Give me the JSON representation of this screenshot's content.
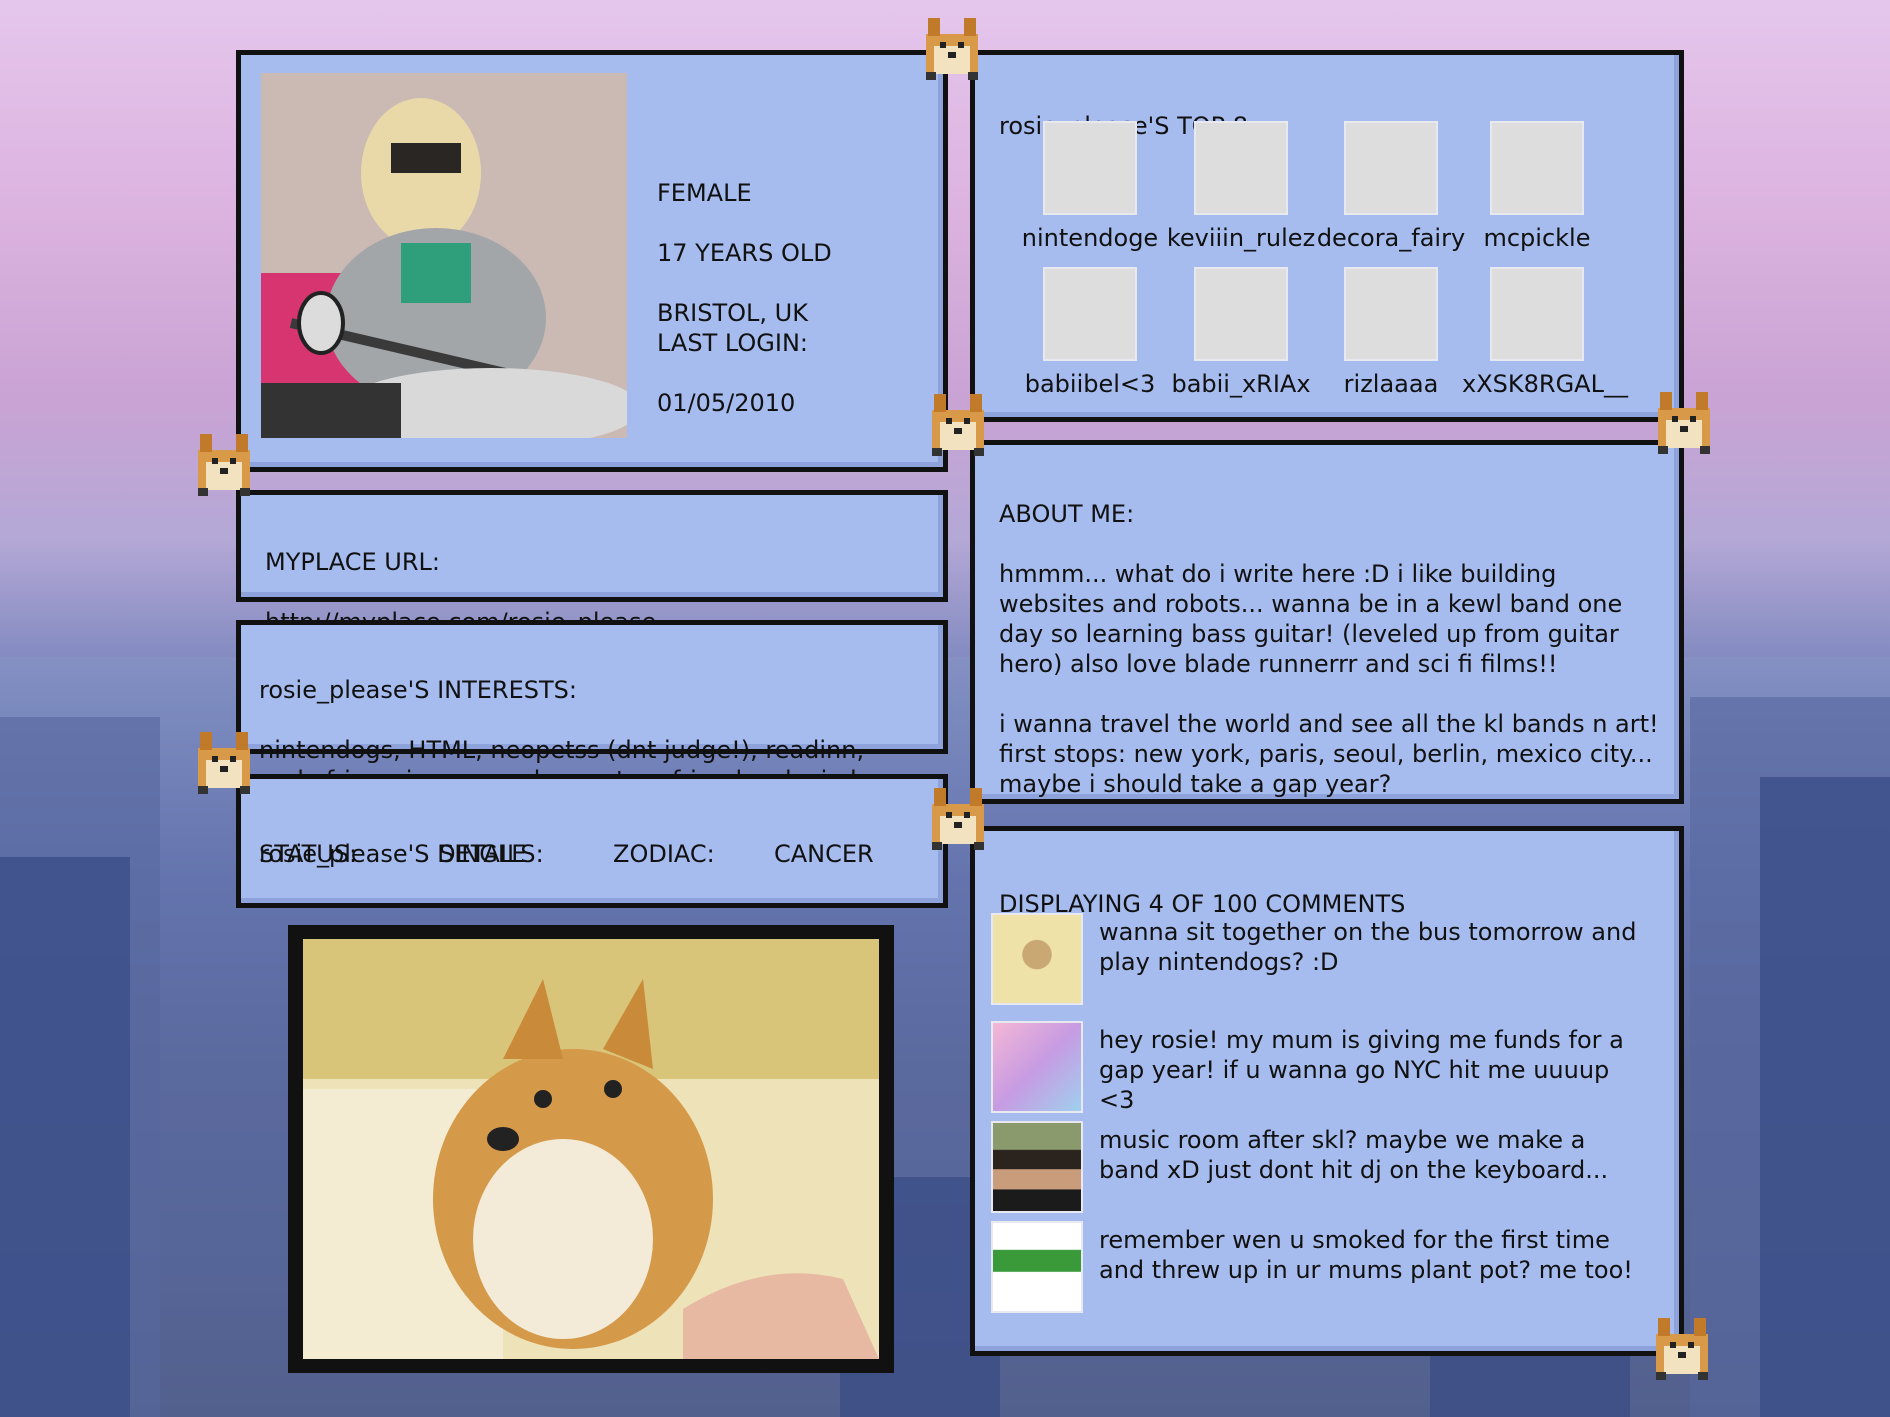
{
  "profile": {
    "photo_alt": "photo-icon",
    "gender": "FEMALE",
    "age": "17 YEARS OLD",
    "location": "BRISTOL, UK",
    "last_login_label": "LAST LOGIN:",
    "last_login_value": "01/05/2010"
  },
  "url_box": {
    "label": "MYPLACE URL:",
    "value": "http://myplace.com/rosie_please"
  },
  "interests": {
    "title": "rosie_please'S INTERESTS:",
    "text": "nintendogs, HTML, neopetss (dnt judge!), readinn, curly fries, simpsonss, happy tree friends, playin bass :D"
  },
  "details": {
    "title": "rosie_please'S DETAILS:",
    "status_label": "STATUS:",
    "status_value": "SINGLE",
    "zodiac_label": "ZODIAC:",
    "zodiac_value": "CANCER"
  },
  "top8": {
    "title": "rosie_please'S TOP 8:",
    "friends": [
      {
        "name": "nintendoge",
        "icon": "dog-avatar"
      },
      {
        "name": "keviiin_rulez",
        "icon": "boy-avatar"
      },
      {
        "name": "decora_fairy",
        "icon": "pink-avatar"
      },
      {
        "name": "mcpickle",
        "icon": "pickle-avatar"
      },
      {
        "name": "babiibel<3",
        "icon": "babybel-avatar"
      },
      {
        "name": "babii_xRIAx",
        "icon": "anime-avatar"
      },
      {
        "name": "rizlaaaa",
        "icon": "rizla-avatar"
      },
      {
        "name": "xXSK8RGAL__",
        "icon": "blur-avatar"
      }
    ]
  },
  "about": {
    "title": "ABOUT ME:",
    "para1": "hmmm... what do i write here :D i like building websites and robots... wanna be in a kewl band one day so learning bass guitar! (leveled up from guitar hero) also love blade runnerrr and sci fi films!!",
    "para2": "i wanna travel the world and see all the kl bands n art! first stops: new york, paris, seoul, berlin, mexico city... maybe i should take a gap year?"
  },
  "comments": {
    "title": "DISPLAYING 4 OF 100 COMMENTS",
    "items": [
      {
        "icon": "dog-avatar",
        "text": "wanna sit together on the bus tomorrow and play nintendogs? :D"
      },
      {
        "icon": "pink-avatar",
        "text": "hey rosie! my mum is giving me funds for a gap year! if u wanna go NYC hit me uuuup <3"
      },
      {
        "icon": "boy-avatar",
        "text": "music room after skl? maybe we make a band xD just dont hit dj on the keyboard..."
      },
      {
        "icon": "rizla-avatar",
        "text": "remember wen u smoked for the first time and threw up in ur mums plant pot? me too!"
      }
    ]
  },
  "doge_image": {
    "icon": "doge-meme-icon"
  },
  "colors": {
    "panel": "#a6bbee",
    "border": "#111111"
  }
}
